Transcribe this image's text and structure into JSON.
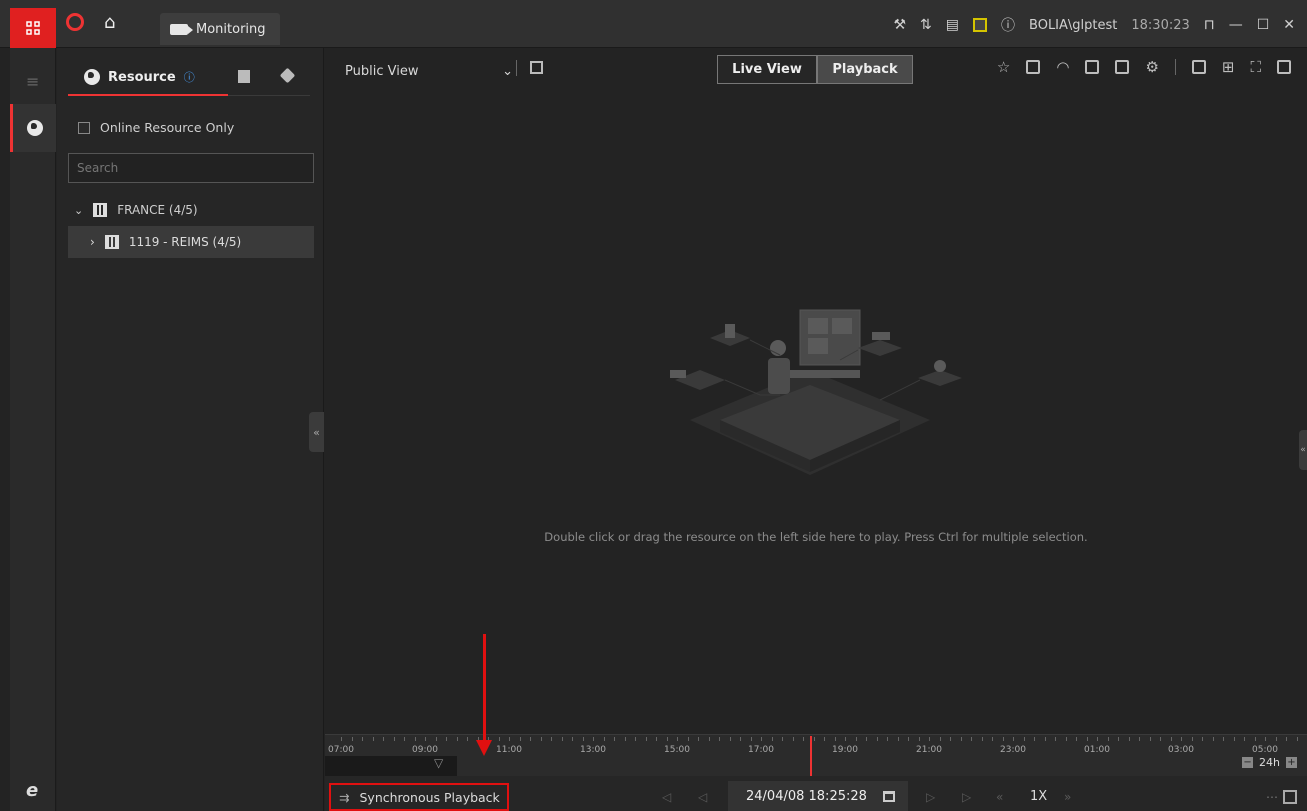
{
  "titlebar": {
    "tab_label": "Monitoring",
    "user": "BOLIA\\glptest",
    "time": "18:30:23"
  },
  "panel": {
    "tab_resource": "Resource",
    "online_only_label": "Online Resource Only",
    "search_placeholder": "Search",
    "tree": [
      {
        "label": "FRANCE (4/5)"
      },
      {
        "label": "1119 - REIMS (4/5)"
      }
    ]
  },
  "toolbar": {
    "view_select": "Public View",
    "live_view_label": "Live View",
    "playback_label": "Playback"
  },
  "main": {
    "hint": "Double click or drag the resource on the left side here to play. Press Ctrl for multiple selection."
  },
  "timeline": {
    "labels": [
      "07:00",
      "09:00",
      "11:00",
      "13:00",
      "15:00",
      "17:00",
      "19:00",
      "21:00",
      "23:00",
      "01:00",
      "03:00",
      "05:00"
    ],
    "zoom_label": "24h"
  },
  "bottombar": {
    "sync_label": "Synchronous Playback",
    "datetime": "24/04/08 18:25:28",
    "speed": "1X"
  },
  "colors": {
    "accent": "#e02020",
    "annotation": "#e01010"
  }
}
